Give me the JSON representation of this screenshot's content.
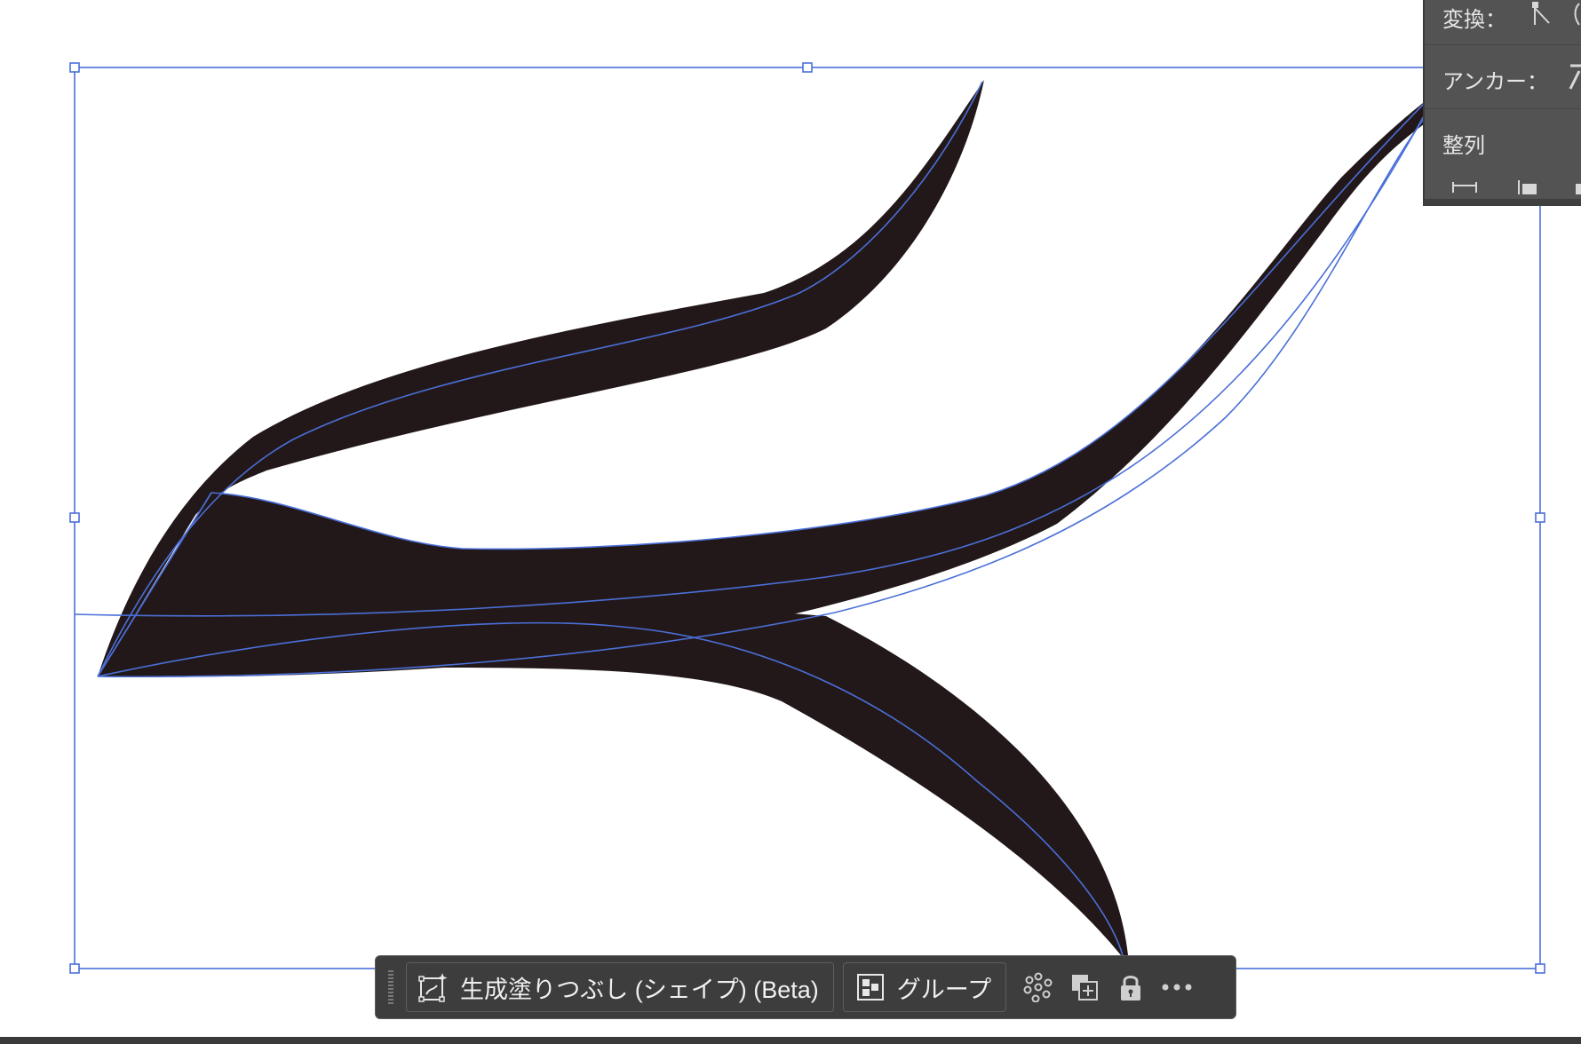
{
  "properties_panel": {
    "transform_label": "変換：",
    "anchor_label": "アンカー：",
    "align_label": "整列"
  },
  "task_bar": {
    "generative_fill_label": "生成塗りつぶし (シェイプ) (Beta)",
    "group_label": "グループ",
    "icons": [
      "recolor-icon",
      "duplicate-icon",
      "lock-icon",
      "more-options-icon"
    ]
  },
  "colors": {
    "shape_fill": "#231819",
    "selection_blue": "#4a6fd8",
    "panel_bg": "#535353",
    "taskbar_bg": "#3d3d3d"
  }
}
